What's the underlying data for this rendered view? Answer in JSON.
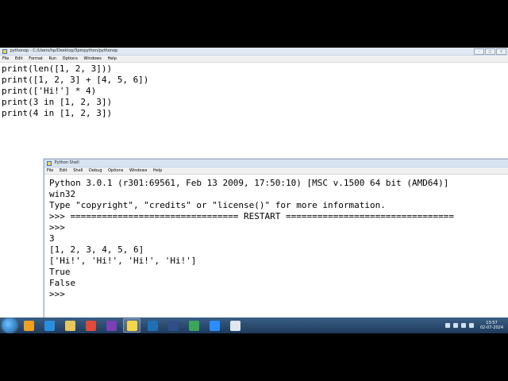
{
  "editor": {
    "title": "pythonop - C:/Users/hp/Desktop/3pmpython/pythonop",
    "menu": [
      "File",
      "Edit",
      "Format",
      "Run",
      "Options",
      "Windows",
      "Help"
    ],
    "lines": [
      "print(len([1, 2, 3]))",
      "print([1, 2, 3] + [4, 5, 6])",
      "print(['Hi!'] * 4)",
      "print(3 in [1, 2, 3])",
      "print(4 in [1, 2, 3])"
    ]
  },
  "shell": {
    "title": "Python Shell",
    "menu": [
      "File",
      "Edit",
      "Shell",
      "Debug",
      "Options",
      "Windows",
      "Help"
    ],
    "lines": [
      "Python 3.0.1 (r301:69561, Feb 13 2009, 17:50:10) [MSC v.1500 64 bit (AMD64)]",
      "win32",
      "Type \"copyright\", \"credits\" or \"license()\" for more information.",
      ">>> ================================ RESTART ================================",
      ">>>",
      "3",
      "[1, 2, 3, 4, 5, 6]",
      "['Hi!', 'Hi!', 'Hi!', 'Hi!']",
      "True",
      "False",
      ">>>"
    ]
  },
  "taskbar": {
    "clock_time": "13:57",
    "clock_date": "02-07-2024",
    "apps": [
      {
        "name": "media-player-icon",
        "color": "#f0a020"
      },
      {
        "name": "ie-icon",
        "color": "#2a8ee0"
      },
      {
        "name": "explorer-icon",
        "color": "#e8c65a"
      },
      {
        "name": "chrome-icon",
        "color": "#e04a3a"
      },
      {
        "name": "visual-studio-icon",
        "color": "#7b3fb6"
      },
      {
        "name": "python-icon",
        "color": "#f4d64a"
      },
      {
        "name": "devcpp-icon",
        "color": "#1f6fb5"
      },
      {
        "name": "app-icon",
        "color": "#2e4e8a"
      },
      {
        "name": "chrome-icon-2",
        "color": "#3aa65a"
      },
      {
        "name": "zoom-icon",
        "color": "#2d8cff"
      },
      {
        "name": "window-icon",
        "color": "#dfe6ee"
      }
    ]
  }
}
